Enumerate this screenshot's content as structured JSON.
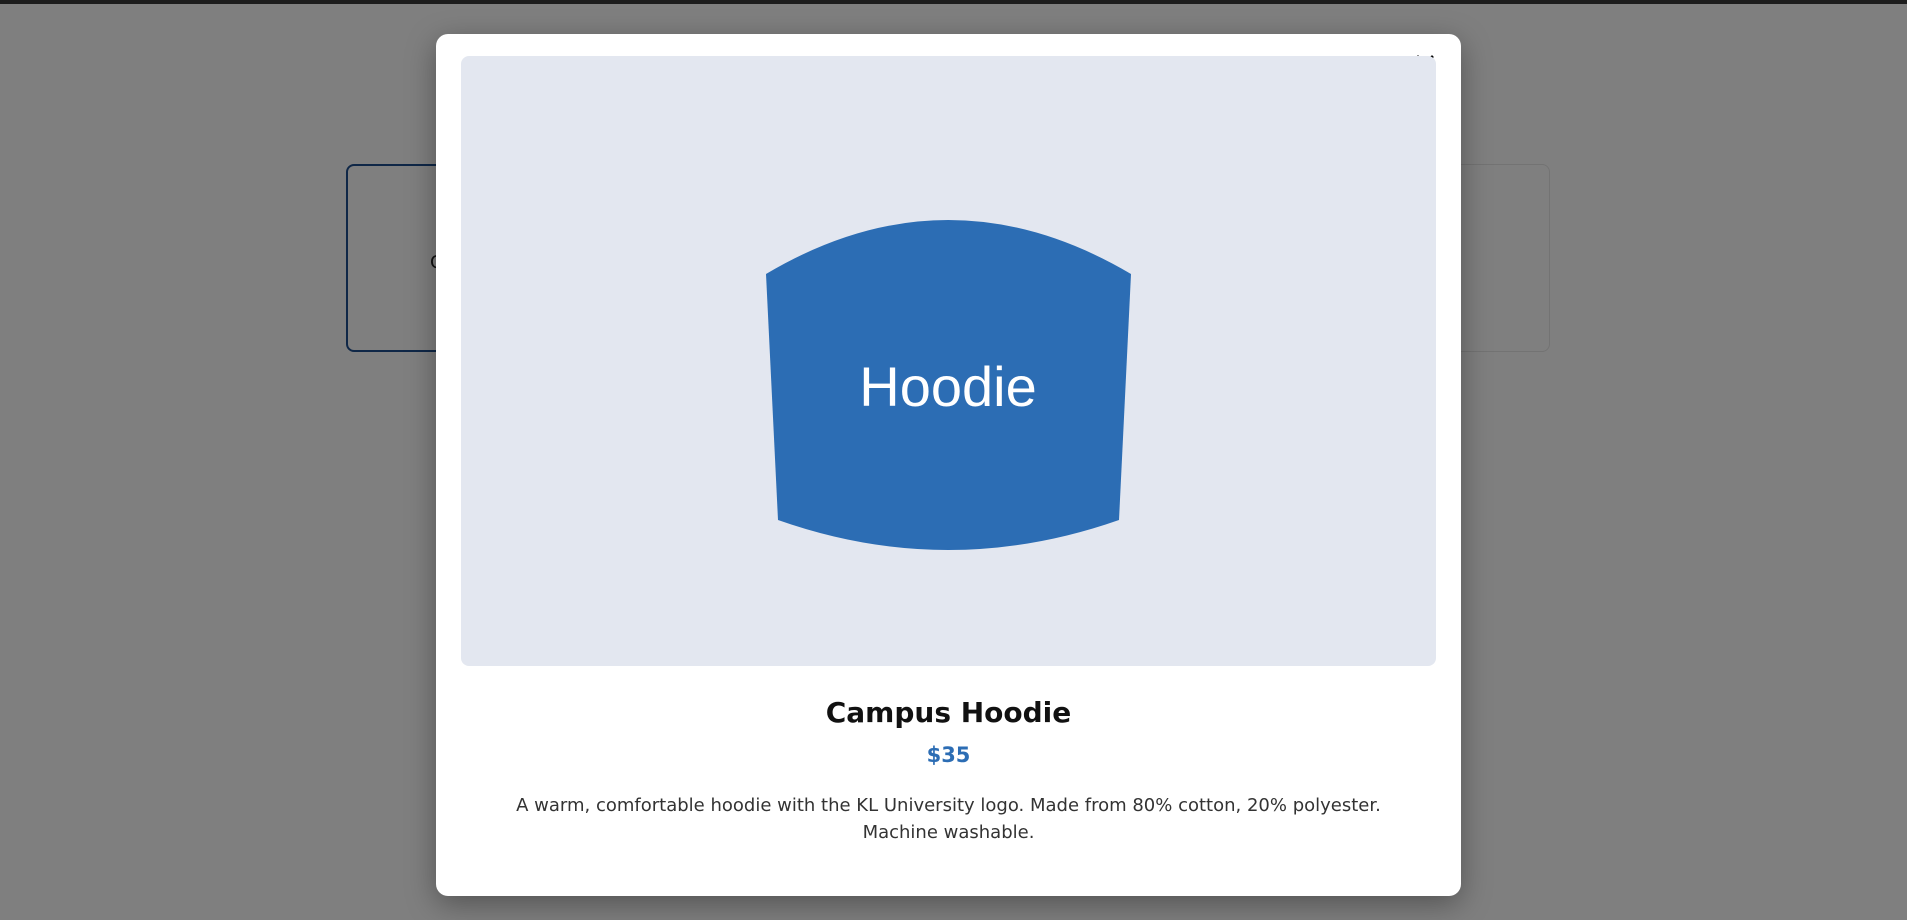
{
  "background": {
    "left_card_text": "C"
  },
  "modal": {
    "close_label": "×",
    "image_label": "Hoodie",
    "title": "Campus Hoodie",
    "price": "$35",
    "description": "A warm, comfortable hoodie with the KL University logo. Made from 80% cotton, 20% polyester. Machine washable."
  },
  "colors": {
    "accent": "#2c6db4",
    "image_bg": "#e3e7f0",
    "overlay": "rgba(0,0,0,0.5)"
  },
  "icons": {
    "close": "close-icon",
    "product": "hoodie-icon"
  }
}
